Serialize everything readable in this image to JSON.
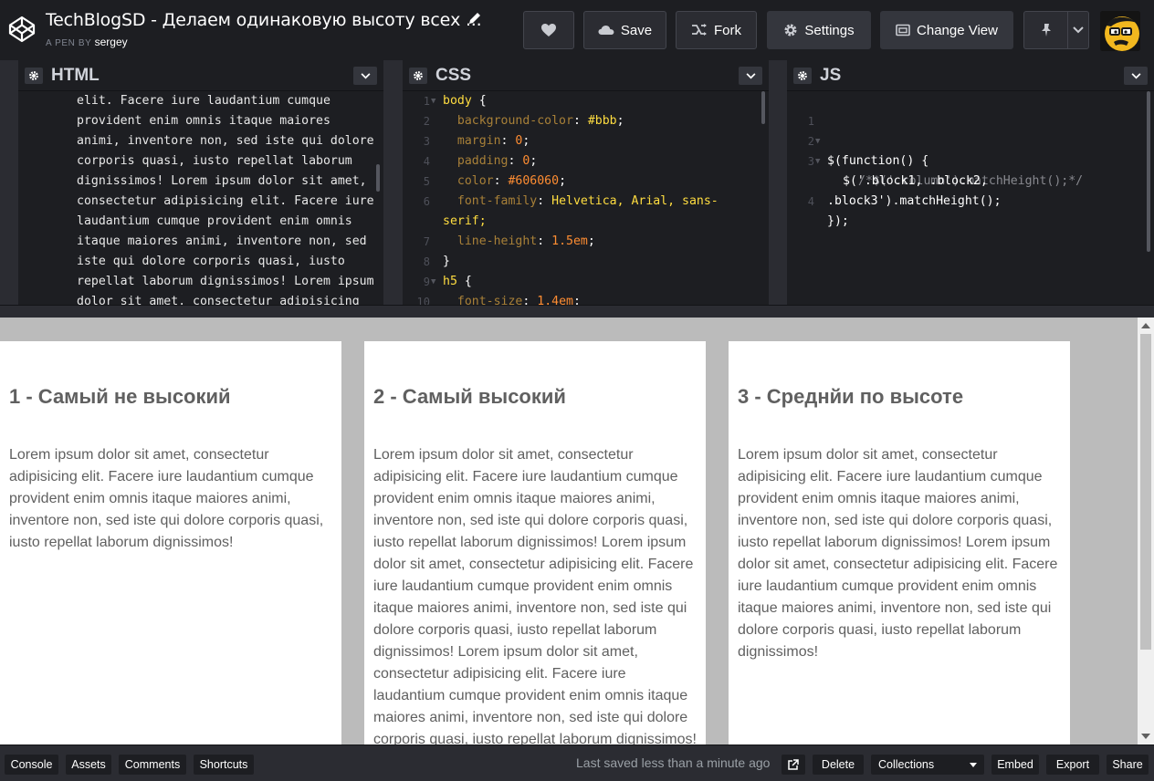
{
  "header": {
    "title": "TechBlogSD - Делаем одинаковую высоту всех ...",
    "pen_by": "A PEN BY",
    "author": "sergey",
    "buttons": {
      "save": "Save",
      "fork": "Fork",
      "settings": "Settings",
      "change_view": "Change View"
    }
  },
  "editors": {
    "html": {
      "title": "HTML",
      "lines": [
        "elit. Facere iure laudantium cumque",
        "provident enim omnis itaque maiores",
        "animi, inventore non, sed iste qui dolore",
        "corporis quasi, iusto repellat laborum",
        "dignissimos! Lorem ipsum dolor sit amet,",
        "consectetur adipisicing elit. Facere iure",
        "laudantium cumque provident enim omnis",
        "itaque maiores animi, inventore non, sed",
        "iste qui dolore corporis quasi, iusto",
        "repellat laborum dignissimos! Lorem ipsum",
        "dolor sit amet, consectetur adipisicing"
      ]
    },
    "css": {
      "title": "CSS",
      "line_numbers": [
        "1",
        "2",
        "3",
        "4",
        "5",
        "6",
        "",
        "7",
        "8",
        "9",
        "10"
      ],
      "lines": [
        {
          "sel": "body",
          "rest": " {"
        },
        {
          "prop": "background-color",
          "val": "#bbb"
        },
        {
          "prop": "margin",
          "val": "0",
          "num": true
        },
        {
          "prop": "padding",
          "val": "0",
          "num": true
        },
        {
          "prop": "color",
          "val": "#606060",
          "num": true
        },
        {
          "prop": "font-family",
          "val": "Helvetica, Arial, sans-"
        },
        {
          "cont": "serif;"
        },
        {
          "prop": "line-height",
          "val": "1.5em",
          "num": true
        },
        {
          "close": "}"
        },
        {
          "sel": "h5",
          "rest": " {"
        },
        {
          "prop": "font-size",
          "val": "1.4em",
          "num": true
        }
      ]
    },
    "js": {
      "title": "JS",
      "line_numbers": [
        "1",
        "2",
        "3",
        "",
        "4"
      ],
      "line1": "$(function() {",
      "line2": "/*$('.column').matchHeight();*/",
      "line3a": "$('.block1, .block2,",
      "line3b": ".block3').matchHeight();",
      "line4": "});"
    }
  },
  "preview": {
    "columns": [
      {
        "heading": "1 - Самый не высокий",
        "text": "Lorem ipsum dolor sit amet, consectetur adipisicing elit. Facere iure laudantium cumque provident enim omnis itaque maiores animi, inventore non, sed iste qui dolore corporis quasi, iusto repellat laborum dignissimos!"
      },
      {
        "heading": "2 - Самый высокий",
        "text": "Lorem ipsum dolor sit amet, consectetur adipisicing elit. Facere iure laudantium cumque provident enim omnis itaque maiores animi, inventore non, sed iste qui dolore corporis quasi, iusto repellat laborum dignissimos! Lorem ipsum dolor sit amet, consectetur adipisicing elit. Facere iure laudantium cumque provident enim omnis itaque maiores animi, inventore non, sed iste qui dolore corporis quasi, iusto repellat laborum dignissimos! Lorem ipsum dolor sit amet, consectetur adipisicing elit. Facere iure laudantium cumque provident enim omnis itaque maiores animi, inventore non, sed iste qui dolore corporis quasi, iusto repellat laborum dignissimos!"
      },
      {
        "heading": "3 - Среднйи по высоте",
        "text": "Lorem ipsum dolor sit amet, consectetur adipisicing elit. Facere iure laudantium cumque provident enim omnis itaque maiores animi, inventore non, sed iste qui dolore corporis quasi, iusto repellat laborum dignissimos! Lorem ipsum dolor sit amet, consectetur adipisicing elit. Facere iure laudantium cumque provident enim omnis itaque maiores animi, inventore non, sed iste qui dolore corporis quasi, iusto repellat laborum dignissimos!"
      }
    ]
  },
  "footer": {
    "console": "Console",
    "assets": "Assets",
    "comments": "Comments",
    "shortcuts": "Shortcuts",
    "saved": "Last saved less than a minute ago",
    "delete": "Delete",
    "collections": "Collections",
    "embed": "Embed",
    "export": "Export",
    "share": "Share"
  },
  "colors": {
    "bg_dark": "#1d1e22",
    "bg_mid": "#2b2c32",
    "preview_bg": "#bbb",
    "text": "#606060"
  }
}
